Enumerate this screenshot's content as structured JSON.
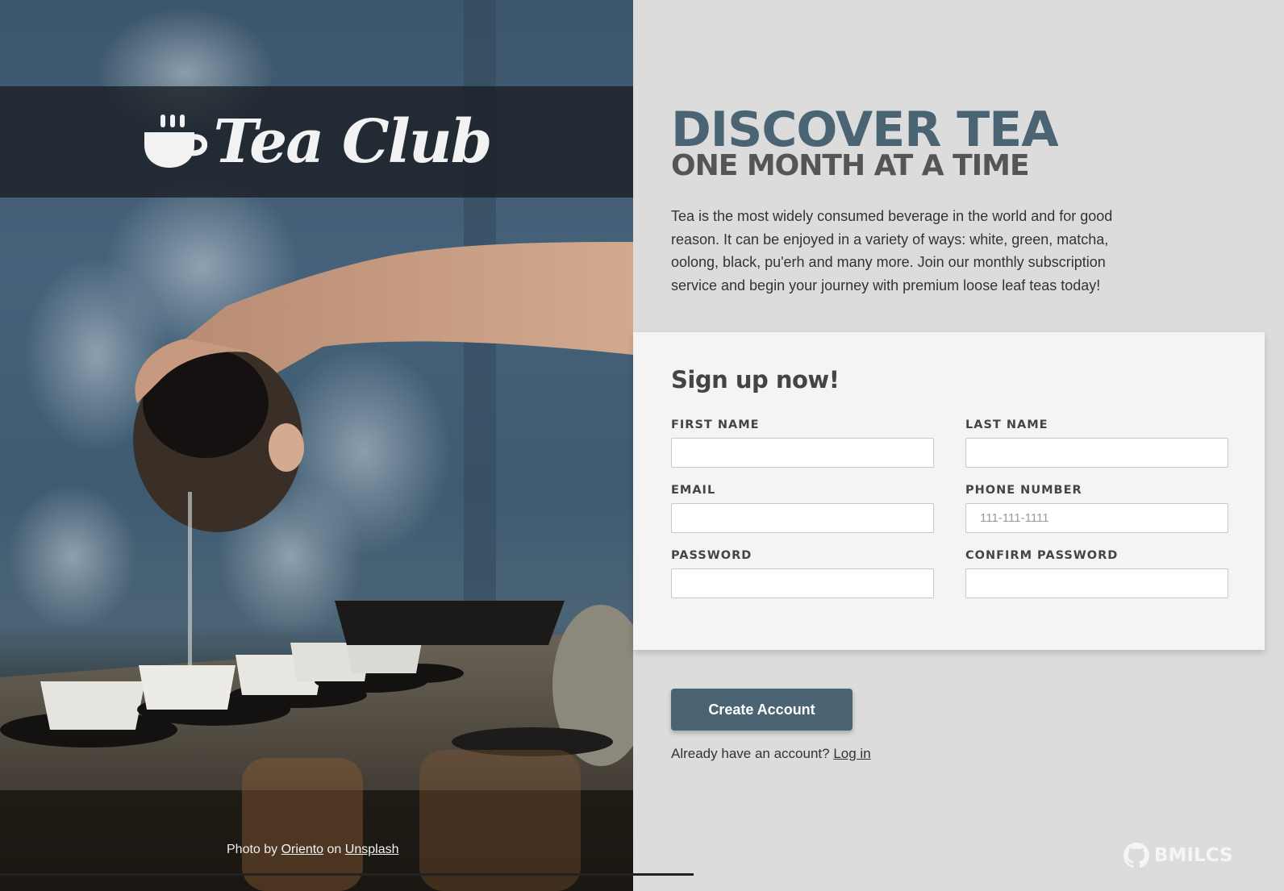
{
  "brand": {
    "name": "Tea Club",
    "icon": "coffee-cup-icon"
  },
  "photo_credit": {
    "prefix": "Photo by",
    "author": "Oriento",
    "middle": "on",
    "source": "Unsplash"
  },
  "intro": {
    "headline": "DISCOVER TEA",
    "subheadline": "ONE MONTH AT A TIME",
    "blurb": "Tea is the most widely consumed beverage in the world and for good reason. It can be enjoyed in a variety of ways: white, green, matcha, oolong, black, pu'erh and many more. Join our monthly subscription service and begin your journey with premium loose leaf teas today!"
  },
  "form": {
    "title": "Sign up now!",
    "fields": {
      "first_name": {
        "label": "FIRST NAME",
        "value": "",
        "placeholder": ""
      },
      "last_name": {
        "label": "LAST NAME",
        "value": "",
        "placeholder": ""
      },
      "email": {
        "label": "EMAIL",
        "value": "",
        "placeholder": ""
      },
      "phone": {
        "label": "PHONE NUMBER",
        "value": "",
        "placeholder": "111-111-1111"
      },
      "password": {
        "label": "PASSWORD",
        "value": "",
        "placeholder": ""
      },
      "confirm_password": {
        "label": "CONFIRM PASSWORD",
        "value": "",
        "placeholder": ""
      }
    }
  },
  "actions": {
    "create_account": "Create Account",
    "login_prompt": "Already have an account?",
    "login_link": "Log in"
  },
  "footer": {
    "github_label": "BMILCS",
    "github_icon": "github-icon"
  },
  "colors": {
    "accent": "#4a6473",
    "panel": "#f4f4f4",
    "page": "#dcdcdc"
  }
}
